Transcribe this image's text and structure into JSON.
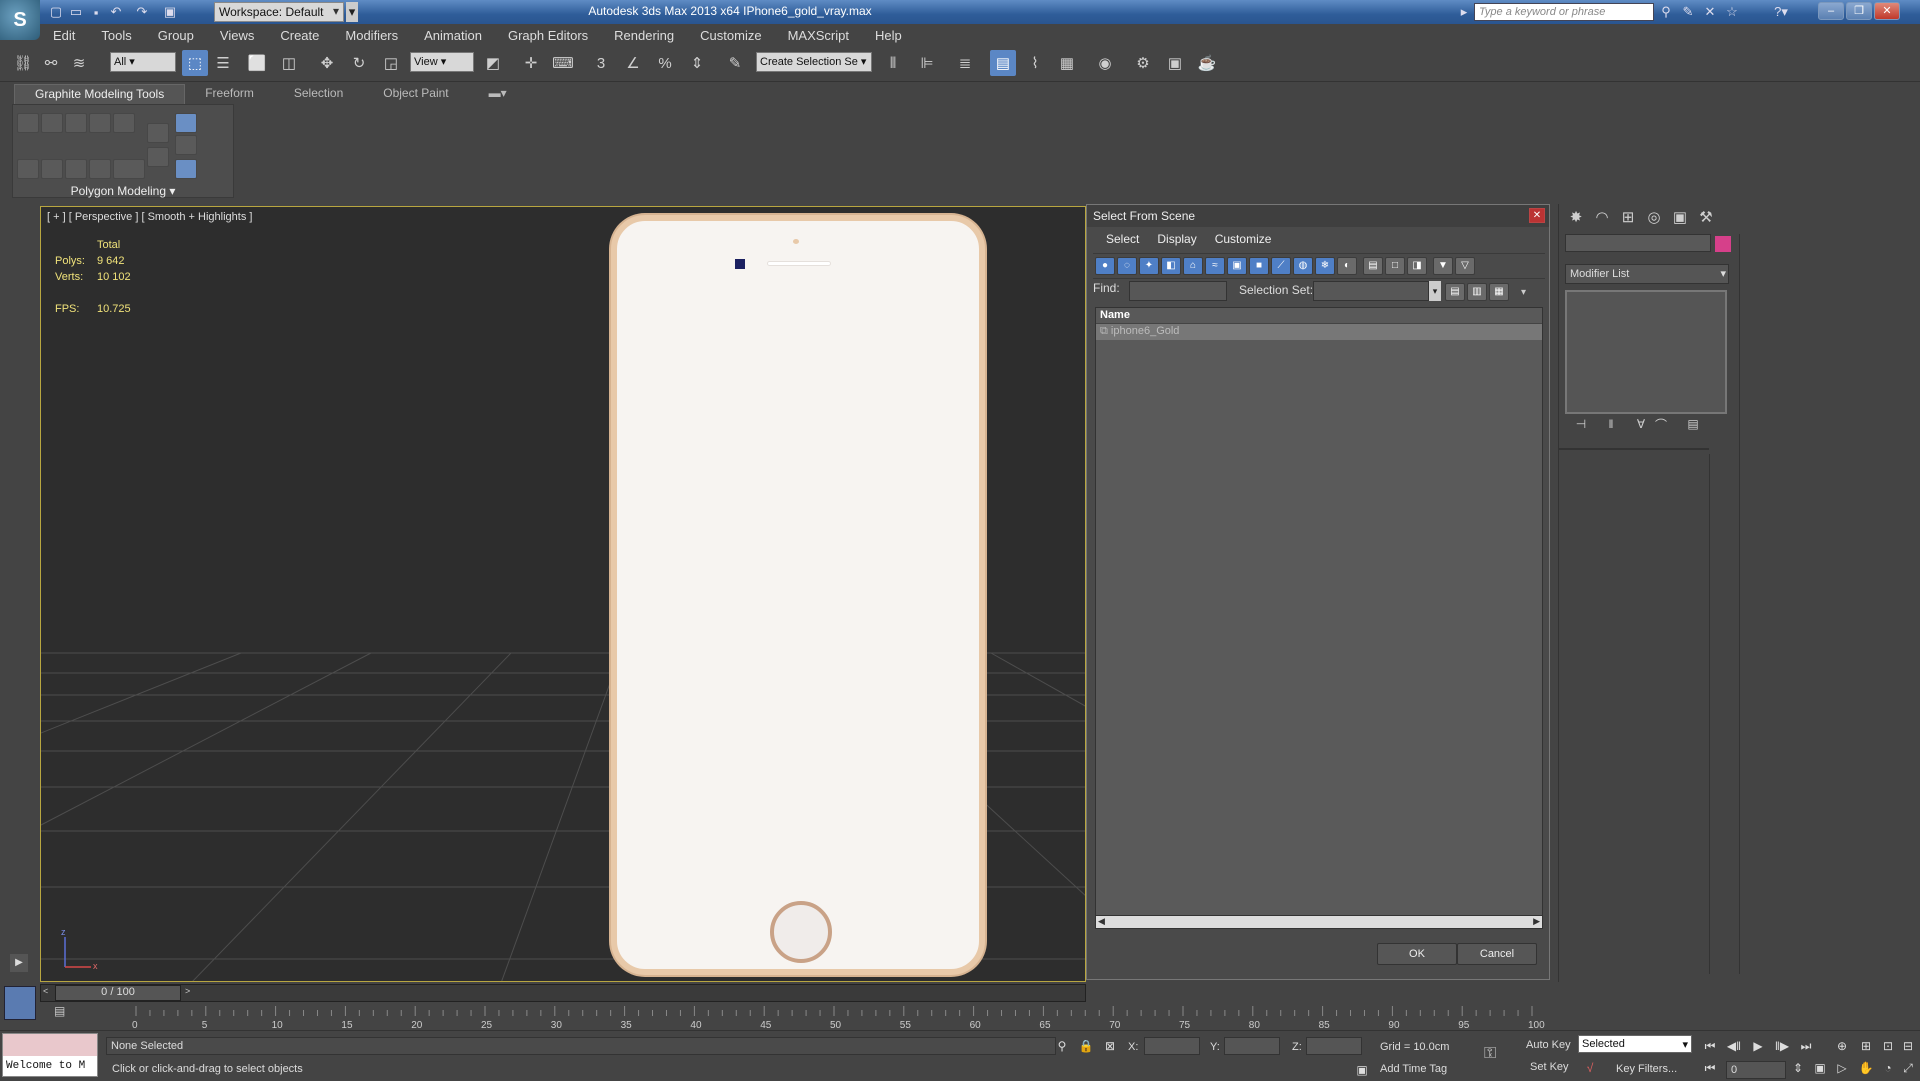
{
  "app": {
    "title": "Autodesk 3ds Max  2013 x64    IPhone6_gold_vray.max",
    "logo_glyph": "S",
    "workspace": "Workspace: Default",
    "search_placeholder": "Type a keyword or phrase",
    "window_controls": [
      "–",
      "❐",
      "✕"
    ]
  },
  "menu": [
    "Edit",
    "Tools",
    "Group",
    "Views",
    "Create",
    "Modifiers",
    "Animation",
    "Graph Editors",
    "Rendering",
    "Customize",
    "MAXScript",
    "Help"
  ],
  "toolbar": {
    "filter": "All",
    "ref_coord": "View",
    "named_selection": "Create Selection Se",
    "snap_labels": [
      "3",
      "%"
    ]
  },
  "ribbon": {
    "tabs": [
      "Graphite Modeling Tools",
      "Freeform",
      "Selection",
      "Object Paint"
    ],
    "panel_label": "Polygon Modeling"
  },
  "viewport": {
    "label": "[ + ] [ Perspective ] [ Smooth + Highlights ]",
    "stats_header": "Total",
    "polys_label": "Polys:",
    "polys_value": "9 642",
    "verts_label": "Verts:",
    "verts_value": "10 102",
    "fps_label": "FPS:",
    "fps_value": "10.725",
    "axis_z": "z",
    "axis_x": "x"
  },
  "dialog": {
    "title": "Select From Scene",
    "menu": [
      "Select",
      "Display",
      "Customize"
    ],
    "find_label": "Find:",
    "selection_set_label": "Selection Set:",
    "column_name": "Name",
    "rows": [
      "iphone6_Gold"
    ],
    "ok": "OK",
    "cancel": "Cancel"
  },
  "command_panel": {
    "modifier_list": "Modifier List",
    "color_swatch": "#d6408a"
  },
  "timeline": {
    "frame_label": "0 / 100",
    "ticks": [
      "0",
      "5",
      "10",
      "15",
      "20",
      "25",
      "30",
      "35",
      "40",
      "45",
      "50",
      "55",
      "60",
      "65",
      "70",
      "75",
      "80",
      "85",
      "90",
      "95",
      "100"
    ]
  },
  "status": {
    "maxscript_text": "Welcome to M",
    "selection": "None Selected",
    "prompt": "Click or click-and-drag to select objects",
    "x_label": "X:",
    "y_label": "Y:",
    "z_label": "Z:",
    "grid": "Grid = 10.0cm",
    "add_time_tag": "Add Time Tag",
    "auto_key": "Auto Key",
    "set_key": "Set Key",
    "selected_dropdown": "Selected",
    "key_filters": "Key Filters...",
    "frame_field": "0"
  }
}
